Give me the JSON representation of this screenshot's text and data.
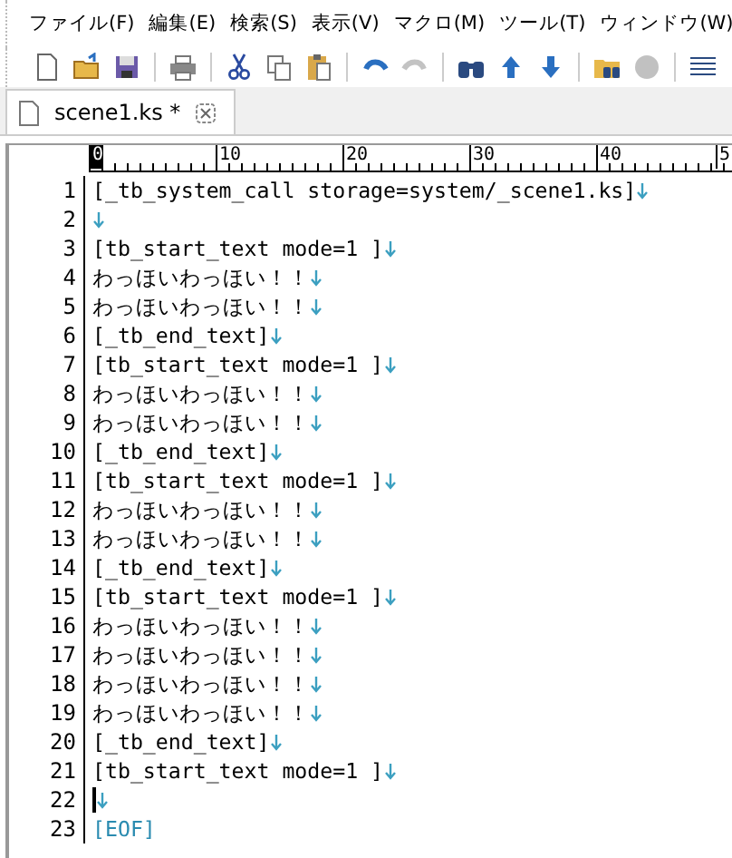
{
  "menu": [
    {
      "label": "ファイル(F)"
    },
    {
      "label": "編集(E)"
    },
    {
      "label": "検索(S)"
    },
    {
      "label": "表示(V)"
    },
    {
      "label": "マクロ(M)"
    },
    {
      "label": "ツール(T)"
    },
    {
      "label": "ウィンドウ(W)"
    }
  ],
  "toolbar": [
    [
      {
        "kind": "new",
        "disabled": false
      },
      {
        "kind": "open",
        "disabled": false
      },
      {
        "kind": "save",
        "disabled": false
      }
    ],
    [
      {
        "kind": "print",
        "disabled": false
      }
    ],
    [
      {
        "kind": "cut",
        "disabled": false
      },
      {
        "kind": "copy",
        "disabled": false
      },
      {
        "kind": "paste",
        "disabled": false
      }
    ],
    [
      {
        "kind": "undo",
        "disabled": false
      },
      {
        "kind": "redo",
        "disabled": true
      }
    ],
    [
      {
        "kind": "find",
        "disabled": false
      },
      {
        "kind": "up",
        "disabled": false
      },
      {
        "kind": "down",
        "disabled": false
      }
    ],
    [
      {
        "kind": "grep",
        "disabled": false
      },
      {
        "kind": "record",
        "disabled": true
      }
    ],
    [
      {
        "kind": "lines",
        "disabled": false
      }
    ]
  ],
  "tabs": [
    {
      "label": "scene1.ks *",
      "selected": true
    }
  ],
  "ruler": [
    {
      "label": "0",
      "selected": true
    },
    {
      "label": "10",
      "selected": false
    },
    {
      "label": "20",
      "selected": false
    },
    {
      "label": "30",
      "selected": false
    },
    {
      "label": "40",
      "selected": false
    },
    {
      "label": "5",
      "selected": false
    }
  ],
  "lines": [
    {
      "number": "1",
      "text": "[_tb_system_call storage=system/_scene1.ks]",
      "cursor": false
    },
    {
      "number": "2",
      "cursor": false
    },
    {
      "number": "3",
      "text": "[tb_start_text mode=1 ]",
      "cursor": false
    },
    {
      "number": "4",
      "text": "わっほいわっほい！！",
      "cursor": false
    },
    {
      "number": "5",
      "text": "わっほいわっほい！！",
      "cursor": false
    },
    {
      "number": "6",
      "text": "[_tb_end_text]",
      "cursor": false
    },
    {
      "number": "7",
      "text": "[tb_start_text mode=1 ]",
      "cursor": false
    },
    {
      "number": "8",
      "text": "わっほいわっほい！！",
      "cursor": false
    },
    {
      "number": "9",
      "text": "わっほいわっほい！！",
      "cursor": false
    },
    {
      "number": "10",
      "text": "[_tb_end_text]",
      "cursor": false
    },
    {
      "number": "11",
      "text": "[tb_start_text mode=1 ]",
      "cursor": false
    },
    {
      "number": "12",
      "text": "わっほいわっほい！！",
      "cursor": false
    },
    {
      "number": "13",
      "text": "わっほいわっほい！！",
      "cursor": false
    },
    {
      "number": "14",
      "text": "[_tb_end_text]",
      "cursor": false
    },
    {
      "number": "15",
      "text": "[tb_start_text mode=1 ]",
      "cursor": false
    },
    {
      "number": "16",
      "text": "わっほいわっほい！！",
      "cursor": false
    },
    {
      "number": "17",
      "text": "わっほいわっほい！！",
      "cursor": false
    },
    {
      "number": "18",
      "text": "わっほいわっほい！！",
      "cursor": false
    },
    {
      "number": "19",
      "text": "わっほいわっほい！！",
      "cursor": false
    },
    {
      "number": "20",
      "text": "[_tb_end_text]",
      "cursor": false
    },
    {
      "number": "21",
      "text": "[tb_start_text mode=1 ]",
      "cursor": false
    },
    {
      "number": "22",
      "cursor": true
    }
  ],
  "eof": {
    "number": "23",
    "text": "[EOF]"
  }
}
